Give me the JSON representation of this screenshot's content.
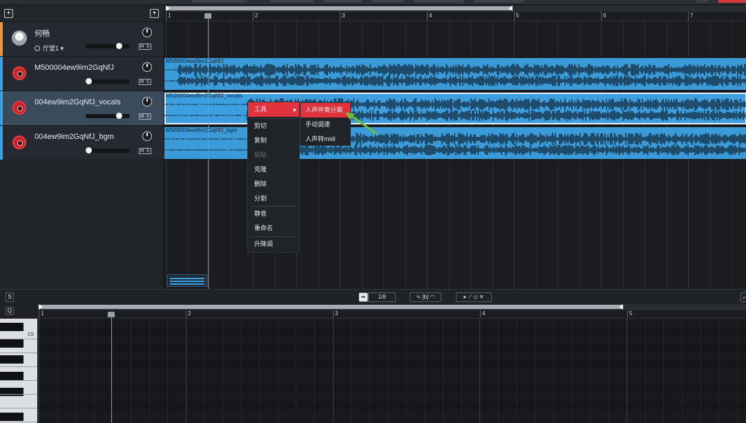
{
  "tracks": [
    {
      "name": "何畅",
      "room": "厅堂1",
      "color": "#e8963a",
      "kind": "avatar"
    },
    {
      "name": "M500004ew9im2GqNfJ",
      "color": "#3e9fe0",
      "kind": "rec"
    },
    {
      "name": "004ew9im2GqNfJ_vocals",
      "color": "#3e9fe0",
      "kind": "rec",
      "selected": true
    },
    {
      "name": "004ew9im2GqNfJ_bgm",
      "color": "#3e9fe0",
      "kind": "rec"
    }
  ],
  "ms_label": "M S",
  "ruler": [
    "1",
    "2",
    "3",
    "4",
    "5",
    "6",
    "7"
  ],
  "clips": [
    {
      "name": "M500004ew9im2GqNfJ"
    },
    {
      "name": "M500004ew9im2GqNfJ_vocals"
    },
    {
      "name": "M500004ew9im2GqNfJ_bgm"
    }
  ],
  "context_menu": {
    "items": [
      {
        "label": "工具",
        "active": true
      },
      {
        "label": "剪切"
      },
      {
        "label": "复制"
      },
      {
        "label": "粘贴",
        "disabled": true
      },
      {
        "label": "克隆"
      },
      {
        "label": "删除"
      },
      {
        "label": "分割"
      },
      {
        "label": "静音"
      },
      {
        "label": "重命名"
      },
      {
        "label": "升降调"
      }
    ],
    "submenu": [
      "人声伴奏分离",
      "手动调速",
      "人声转midi"
    ]
  },
  "editor": {
    "s_label": "S",
    "q_label": "Q",
    "quantize": "1/8",
    "snap_label": "[b]",
    "note_label": "C5",
    "ruler": [
      "1",
      "2",
      "3",
      "4",
      "5"
    ]
  },
  "colors": {
    "accent": "#e0333d",
    "clip": "#3e9fe0",
    "arrow": "#6fbf3a"
  }
}
